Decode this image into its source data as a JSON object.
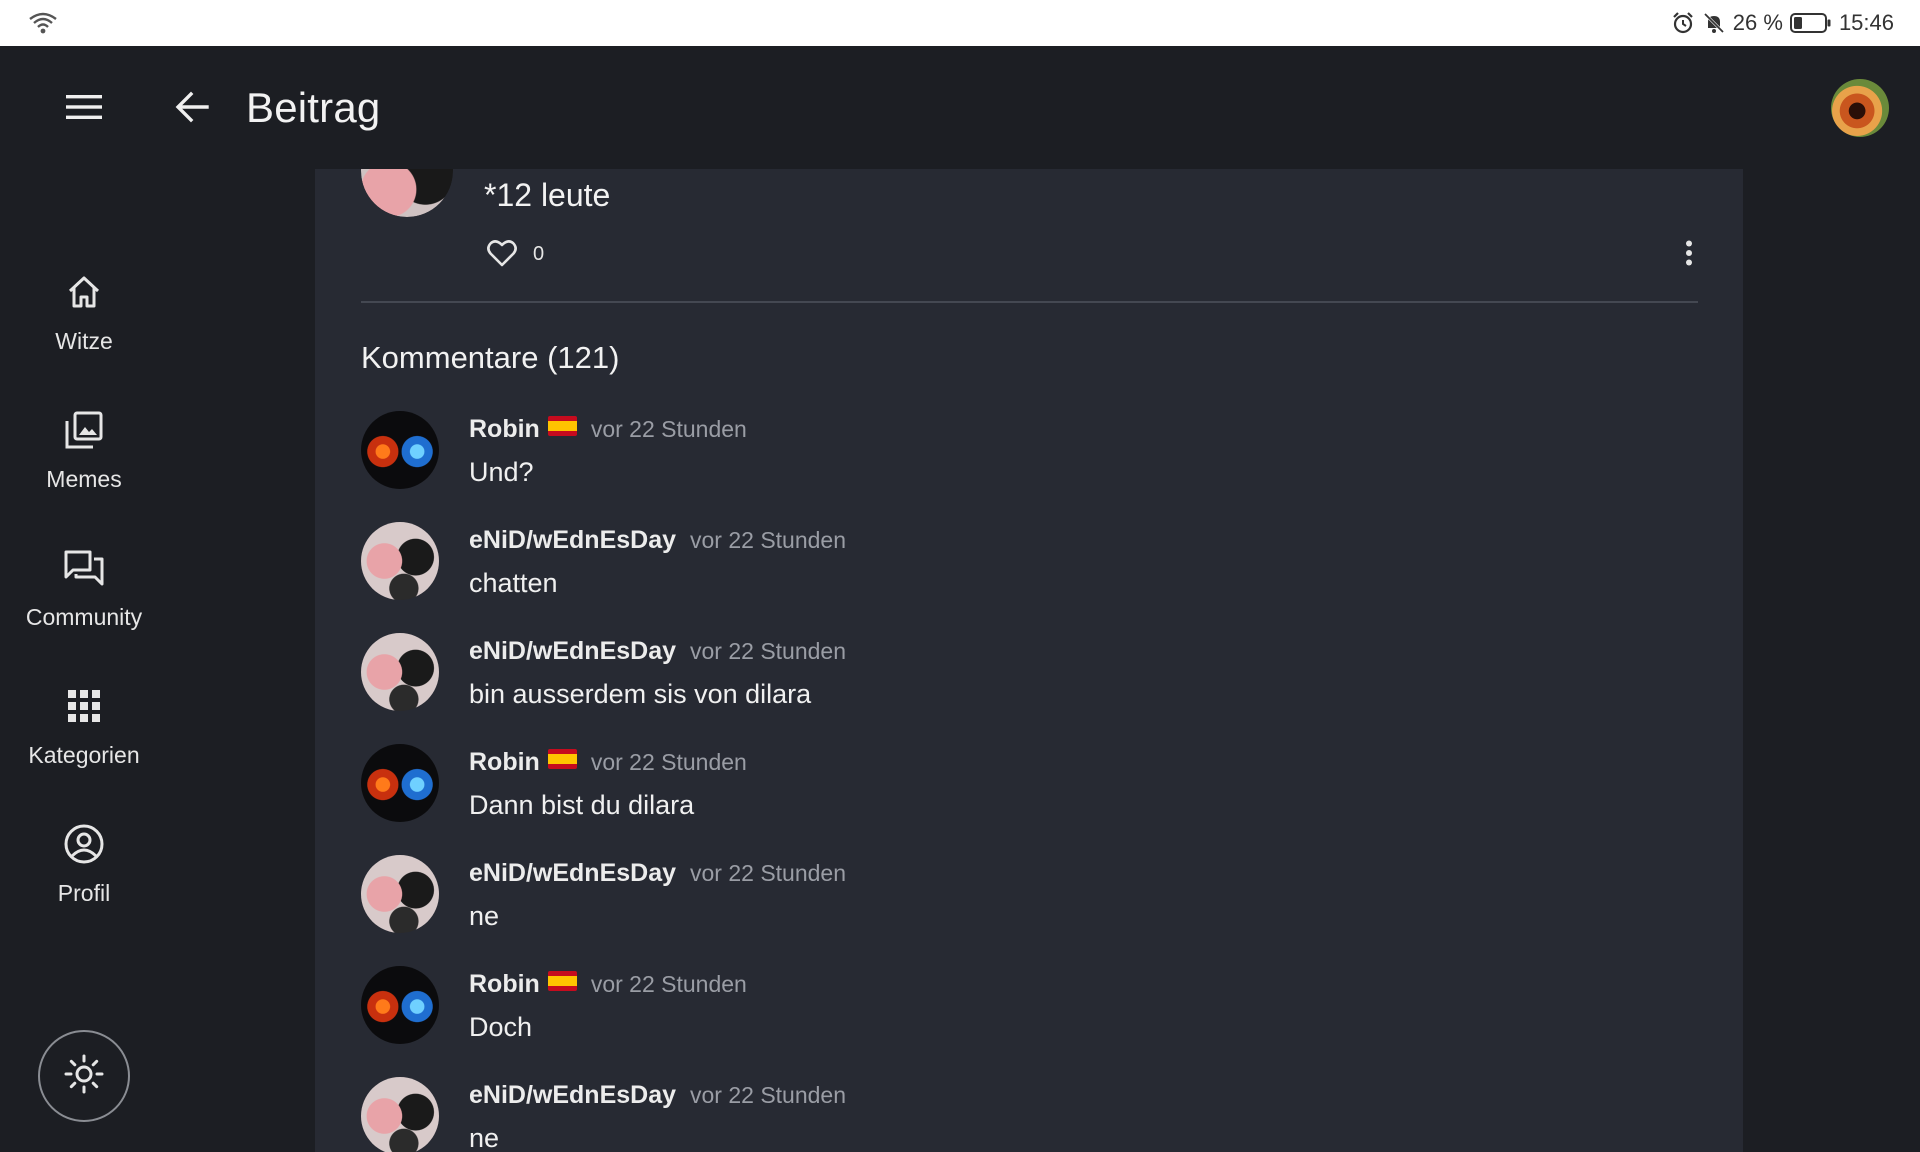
{
  "status_bar": {
    "battery_percent": "26 %",
    "time": "15:46"
  },
  "app_bar": {
    "title": "Beitrag"
  },
  "nav": {
    "items": [
      {
        "label": "Witze",
        "icon": "home-icon"
      },
      {
        "label": "Memes",
        "icon": "images-icon"
      },
      {
        "label": "Community",
        "icon": "forum-icon"
      },
      {
        "label": "Kategorien",
        "icon": "grid-icon"
      },
      {
        "label": "Profil",
        "icon": "account-circle-icon"
      }
    ]
  },
  "post": {
    "text": "*12 leute",
    "like_count": "0"
  },
  "comments_heading": "Kommentare (121)",
  "comments": [
    {
      "author": "Robin",
      "flag": "spain-flag",
      "time": "vor 22 Stunden",
      "text": "Und?"
    },
    {
      "author": "eNiD/wEdnEsDay",
      "time": "vor 22 Stunden",
      "text": "chatten"
    },
    {
      "author": "eNiD/wEdnEsDay",
      "time": "vor 22 Stunden",
      "text": "bin ausserdem sis von dilara"
    },
    {
      "author": "Robin",
      "flag": "spain-flag",
      "time": "vor 22 Stunden",
      "text": "Dann bist du dilara"
    },
    {
      "author": "eNiD/wEdnEsDay",
      "time": "vor 22 Stunden",
      "text": "ne"
    },
    {
      "author": "Robin",
      "flag": "spain-flag",
      "time": "vor 22 Stunden",
      "text": "Doch"
    },
    {
      "author": "eNiD/wEdnEsDay",
      "time": "vor 22 Stunden",
      "text": "ne"
    }
  ],
  "colors": {
    "background": "#1c1e23",
    "card": "#272a33",
    "muted_text": "#9a9da5"
  }
}
